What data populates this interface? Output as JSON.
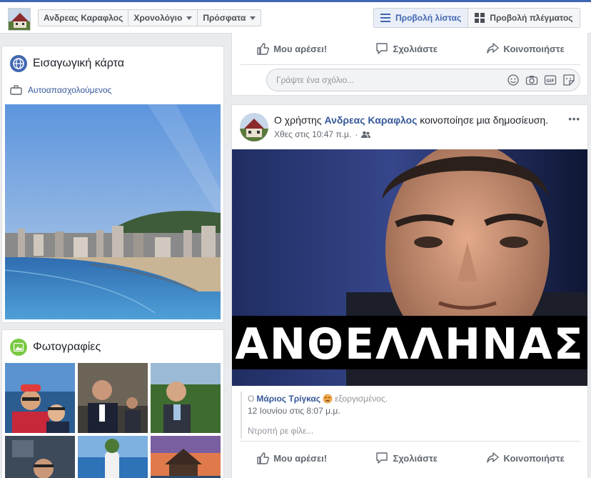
{
  "header": {
    "profile_name": "Ανδρεας Καραφλος",
    "timeline": "Χρονολόγιο",
    "recent": "Πρόσφατα",
    "list_view": "Προβολή λίστας",
    "grid_view": "Προβολή πλέγματος"
  },
  "intro": {
    "title": "Εισαγωγική κάρτα",
    "job": "Αυτοαπασχολούμενος"
  },
  "photos": {
    "title": "Φωτογραφίες"
  },
  "actions": {
    "like": "Μου αρέσει!",
    "comment": "Σχολιάστε",
    "share": "Κοινοποιήστε"
  },
  "comment_box": {
    "placeholder": "Γράψτε ένα σχόλιο..."
  },
  "post": {
    "prefix": "Ο χρήστης",
    "author": "Ανδρεας Καραφλος",
    "suffix": "κοινοποίησε μια δημοσίευση.",
    "time": "Χθες στις 10:47 π.μ.",
    "banner_text": "ΑΝΘΕΛΛΗΝΑΣ",
    "more": "•••"
  },
  "shared": {
    "prefix": "Ο",
    "author": "Μάριος Τρίγκας",
    "feeling": "εξοργισμένος.",
    "time": "12 Ιουνίου στις 8:07 μ.μ.",
    "text": "Ντροπή ρε φίλε..."
  }
}
